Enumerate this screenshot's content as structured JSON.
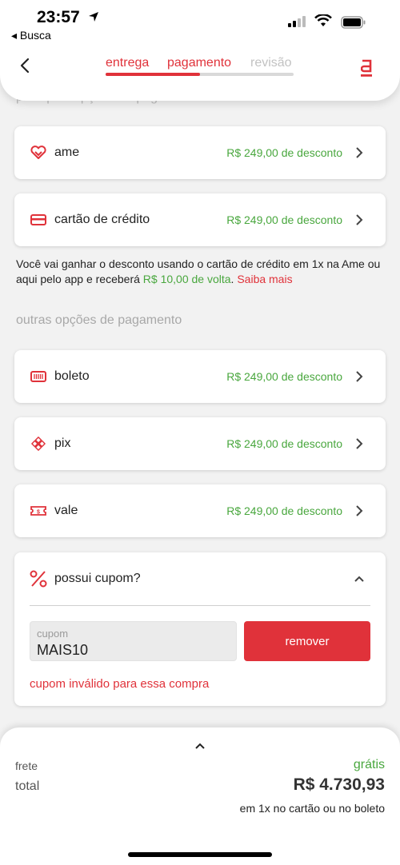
{
  "status_bar": {
    "time": "23:57",
    "back_app": "◂ Busca"
  },
  "steps": [
    {
      "label": "entrega",
      "state": "done"
    },
    {
      "label": "pagamento",
      "state": "active"
    },
    {
      "label": "revisão",
      "state": "pending"
    }
  ],
  "progress": {
    "value_fraction": 0.5
  },
  "top_section_heading": "principais opções de pagamento",
  "main_methods": [
    {
      "label": "ame",
      "discount": "R$ 249,00 de desconto",
      "icon": "ame-heart-icon"
    },
    {
      "label": "cartão de crédito",
      "discount": "R$ 249,00 de desconto",
      "icon": "credit-card-icon"
    }
  ],
  "info": {
    "text_1": "Você vai ganhar o desconto usando o cartão de crédito em 1x na Ame ou aqui pelo app e receberá ",
    "cashback": "R$ 10,00 de volta",
    "text_2": ". ",
    "link": "Saiba mais"
  },
  "other_heading": "outras opções de pagamento",
  "other_methods": [
    {
      "label": "boleto",
      "discount": "R$ 249,00 de desconto",
      "icon": "barcode-icon"
    },
    {
      "label": "pix",
      "discount": "R$ 249,00 de desconto",
      "icon": "pix-icon"
    },
    {
      "label": "vale",
      "discount": "R$ 249,00 de desconto",
      "icon": "voucher-icon"
    }
  ],
  "coupon": {
    "title": "possui cupom?",
    "placeholder": "cupom",
    "value": "MAIS10",
    "button": "remover",
    "error": "cupom inválido para essa compra"
  },
  "summary": {
    "frete_label": "frete",
    "frete_value": "grátis",
    "total_label": "total",
    "total_value": "R$ 4.730,93",
    "installment": "em 1x no cartão ou no boleto"
  },
  "colors": {
    "brand_red": "#e0323a",
    "discount_green": "#49a73e",
    "background": "#f2f2f2"
  }
}
